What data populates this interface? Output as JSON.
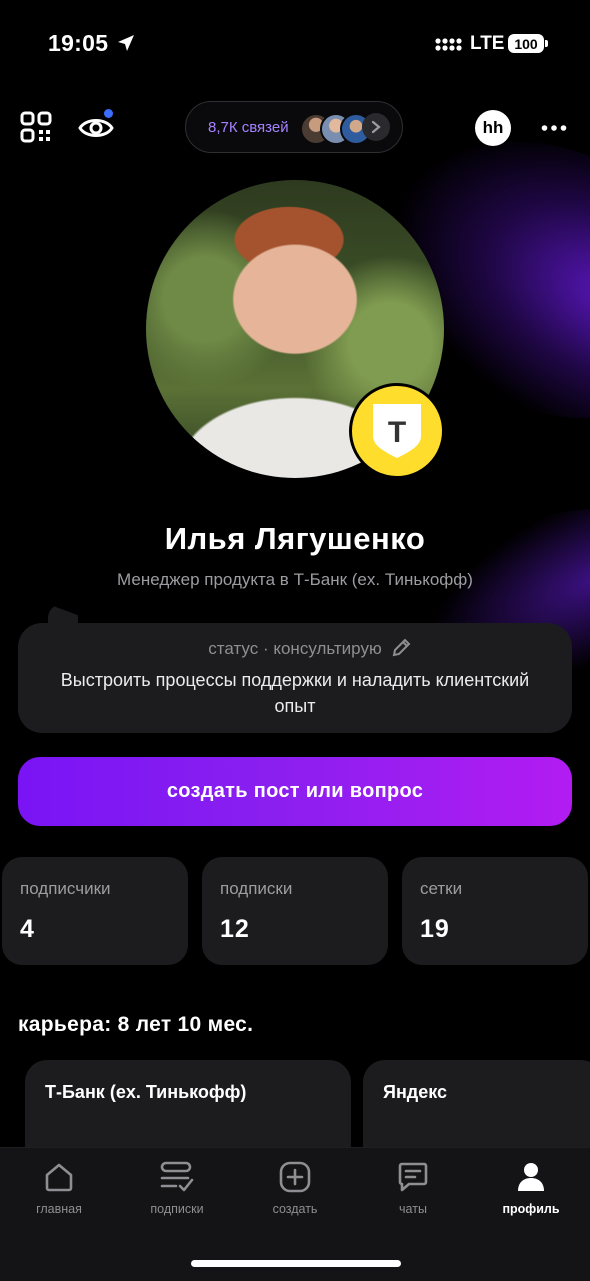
{
  "status_bar": {
    "time": "19:05",
    "network": "LTE",
    "battery": "100"
  },
  "top_bar": {
    "connections_label": "8,7К связей",
    "hh_label": "hh",
    "icons": [
      "qr-code-icon",
      "eye-icon",
      "chevron-right-icon",
      "more-icon"
    ]
  },
  "profile": {
    "name": "Илья Лягушенко",
    "job_title": "Менеджер продукта в Т-Банк (ex. Тинькофф)",
    "badge_letter": "Т"
  },
  "status": {
    "label": "статус · консультирую",
    "text": "Выстроить процессы поддержки и наладить клиентский опыт"
  },
  "create_button_label": "создать пост или вопрос",
  "stats": [
    {
      "label": "подписчики",
      "value": "4"
    },
    {
      "label": "подписки",
      "value": "12"
    },
    {
      "label": "сетки",
      "value": "19"
    }
  ],
  "career": {
    "title": "карьера: 8 лет 10 мес.",
    "companies": [
      "Т-Банк (ex. Тинькофф)",
      "Яндекс"
    ]
  },
  "tabs": [
    {
      "label": "главная",
      "icon": "home-icon",
      "active": false
    },
    {
      "label": "подписки",
      "icon": "subscriptions-icon",
      "active": false
    },
    {
      "label": "создать",
      "icon": "plus-icon",
      "active": false
    },
    {
      "label": "чаты",
      "icon": "chat-icon",
      "active": false
    },
    {
      "label": "профиль",
      "icon": "profile-icon",
      "active": true
    }
  ],
  "colors": {
    "accent": "#8a1ff0",
    "connections_text": "#a583ff",
    "badge_yellow": "#ffdd2d",
    "card_bg": "#1c1c1f"
  }
}
